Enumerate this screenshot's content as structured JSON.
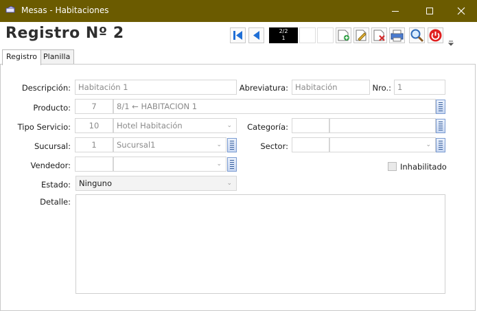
{
  "window": {
    "title": "Mesas - Habitaciones",
    "controls": [
      "minimize",
      "maximize",
      "close"
    ]
  },
  "header": {
    "record_title": "Registro Nº  2",
    "counter_top": "2/2",
    "counter_bottom": "1"
  },
  "toolbar": {
    "buttons": [
      "first-icon",
      "previous-icon",
      "new-icon",
      "edit-icon",
      "delete-icon",
      "print-icon",
      "search-icon",
      "exit-icon",
      "overflow-icon"
    ]
  },
  "tabs": [
    {
      "label": "Registro",
      "active": true
    },
    {
      "label": "Planilla",
      "active": false
    }
  ],
  "form": {
    "descripcion": {
      "label": "Descripción:",
      "value": "Habitación 1"
    },
    "abreviatura": {
      "label": "Abreviatura:",
      "value": "Habitación"
    },
    "nro": {
      "label": "Nro.:",
      "value": "1"
    },
    "producto": {
      "label": "Producto:",
      "code": "7",
      "value": "8/1 ← HABITACION 1"
    },
    "tipo_servicio": {
      "label": "Tipo Servicio:",
      "code": "10",
      "value": "Hotel Habitación"
    },
    "categoria": {
      "label": "Categoría:",
      "code": "",
      "value": ""
    },
    "sucursal": {
      "label": "Sucursal:",
      "code": "1",
      "value": "Sucursal1"
    },
    "sector": {
      "label": "Sector:",
      "code": "",
      "value": ""
    },
    "vendedor": {
      "label": "Vendedor:",
      "code": "",
      "value": ""
    },
    "inhabilitado": {
      "label": "Inhabilitado",
      "checked": false
    },
    "estado": {
      "label": "Estado:",
      "value": "Ninguno"
    },
    "detalle": {
      "label": "Detalle:",
      "value": ""
    }
  },
  "colors": {
    "titlebar": "#6b5b00",
    "title_text": "#2e2e2e",
    "counter_bg": "#000000",
    "picker_border": "#7b9bd1",
    "exit_button": "#e02020"
  }
}
